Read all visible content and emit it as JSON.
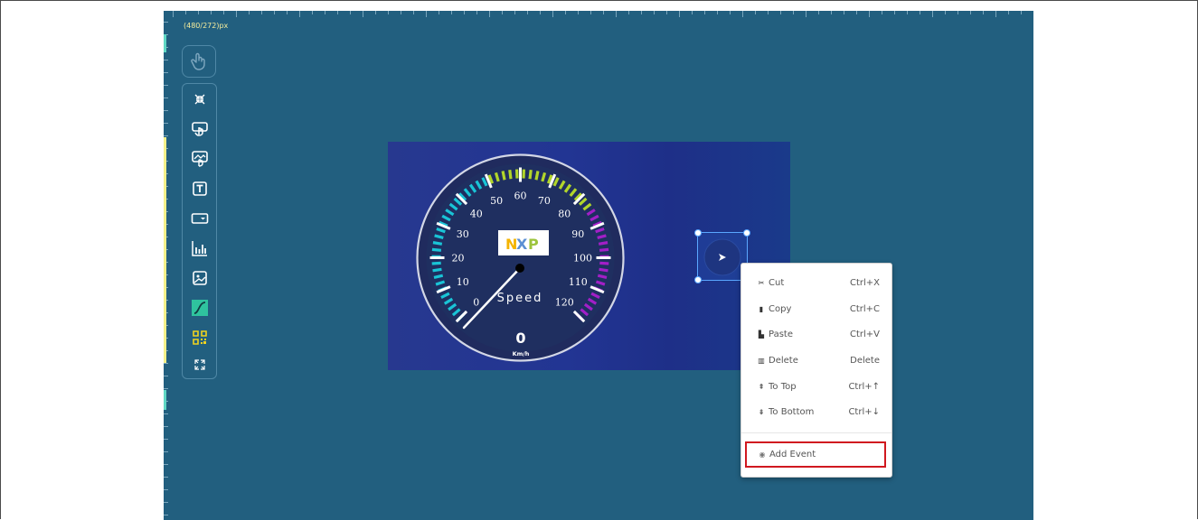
{
  "canvas": {
    "resolution": "(480/272)px"
  },
  "toolbar": {
    "items": [
      {
        "name": "collapse-icon"
      },
      {
        "name": "button-widget-icon"
      },
      {
        "name": "image-button-widget-icon"
      },
      {
        "name": "text-widget-icon"
      },
      {
        "name": "dropdown-widget-icon"
      },
      {
        "name": "chart-widget-icon"
      },
      {
        "name": "image-widget-icon"
      },
      {
        "name": "slider-widget-icon"
      },
      {
        "name": "qrcode-widget-icon"
      },
      {
        "name": "expand-icon"
      }
    ]
  },
  "gauge": {
    "ticks": [
      "0",
      "10",
      "20",
      "30",
      "40",
      "50",
      "60",
      "70",
      "80",
      "90",
      "100",
      "110",
      "120"
    ],
    "title": "Speed",
    "value": "0",
    "unit": "Km/h",
    "logo": "NXP",
    "colors": {
      "low": "#19c4d6",
      "mid": "#b2d62a",
      "high": "#a21fc7"
    }
  },
  "context_menu": {
    "items": [
      {
        "icon": "✂",
        "label": "Cut",
        "shortcut": "Ctrl+X"
      },
      {
        "icon": "▮",
        "label": "Copy",
        "shortcut": "Ctrl+C"
      },
      {
        "icon": "▙",
        "label": "Paste",
        "shortcut": "Ctrl+V"
      },
      {
        "icon": "▥",
        "label": "Delete",
        "shortcut": "Delete"
      },
      {
        "icon": "⇞",
        "label": "To Top",
        "shortcut": "Ctrl+↑"
      },
      {
        "icon": "⇟",
        "label": "To Bottom",
        "shortcut": "Ctrl+↓"
      }
    ],
    "add_event": {
      "icon": "◉",
      "label": "Add Event"
    },
    "highlight_color": "#d0181f"
  }
}
